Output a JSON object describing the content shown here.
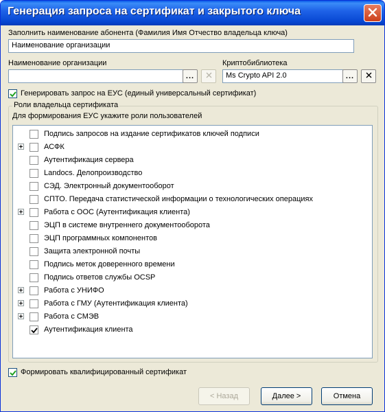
{
  "window": {
    "title": "Генерация запроса на сертификат и закрытого ключа",
    "close_icon": "close-icon"
  },
  "subscriber": {
    "label": "Заполнить наименование абонента (Фамилия Имя Отчество владельца ключа)",
    "value": "Наименование организации"
  },
  "organization": {
    "label": "Наименование организации",
    "value": "",
    "browse_label": "...",
    "clear_icon": "close-icon"
  },
  "crypto": {
    "label": "Криптобиблиотека",
    "value": "Ms Crypto API 2.0",
    "browse_label": "...",
    "clear_icon": "close-icon"
  },
  "generate_eus": {
    "label": "Генерировать запрос на ЕУС (единый универсальный сертификат)",
    "checked": true
  },
  "roles": {
    "group_title": "Роли владельца сертификата",
    "hint": "Для формирования ЕУС укажите роли пользователей",
    "items": [
      {
        "label": "Подпись запросов на издание сертификатов ключей подписи",
        "expandable": false,
        "checked": false
      },
      {
        "label": "АСФК",
        "expandable": true,
        "checked": false
      },
      {
        "label": "Аутентификация сервера",
        "expandable": false,
        "checked": false
      },
      {
        "label": "Landocs. Делопроизводство",
        "expandable": false,
        "checked": false
      },
      {
        "label": "СЭД. Электронный документооборот",
        "expandable": false,
        "checked": false
      },
      {
        "label": "СПТО. Передача статистической информации о технологических операциях",
        "expandable": false,
        "checked": false
      },
      {
        "label": "Работа с ООС (Аутентификация клиента)",
        "expandable": true,
        "checked": false
      },
      {
        "label": "ЭЦП в системе внутреннего документооборота",
        "expandable": false,
        "checked": false
      },
      {
        "label": "ЭЦП программных компонентов",
        "expandable": false,
        "checked": false
      },
      {
        "label": "Защита электронной почты",
        "expandable": false,
        "checked": false
      },
      {
        "label": "Подпись меток доверенного времени",
        "expandable": false,
        "checked": false
      },
      {
        "label": "Подпись ответов службы OCSP",
        "expandable": false,
        "checked": false
      },
      {
        "label": "Работа с УНИФО",
        "expandable": true,
        "checked": false
      },
      {
        "label": "Работа с ГМУ (Аутентификация клиента)",
        "expandable": true,
        "checked": false
      },
      {
        "label": "Работа с СМЭВ",
        "expandable": true,
        "checked": false
      },
      {
        "label": "Аутентификация клиента",
        "expandable": false,
        "checked": true
      }
    ]
  },
  "qualified": {
    "label": "Формировать квалифицированный сертификат",
    "checked": true
  },
  "buttons": {
    "back": "< Назад",
    "next": "Далее >",
    "cancel": "Отмена"
  }
}
